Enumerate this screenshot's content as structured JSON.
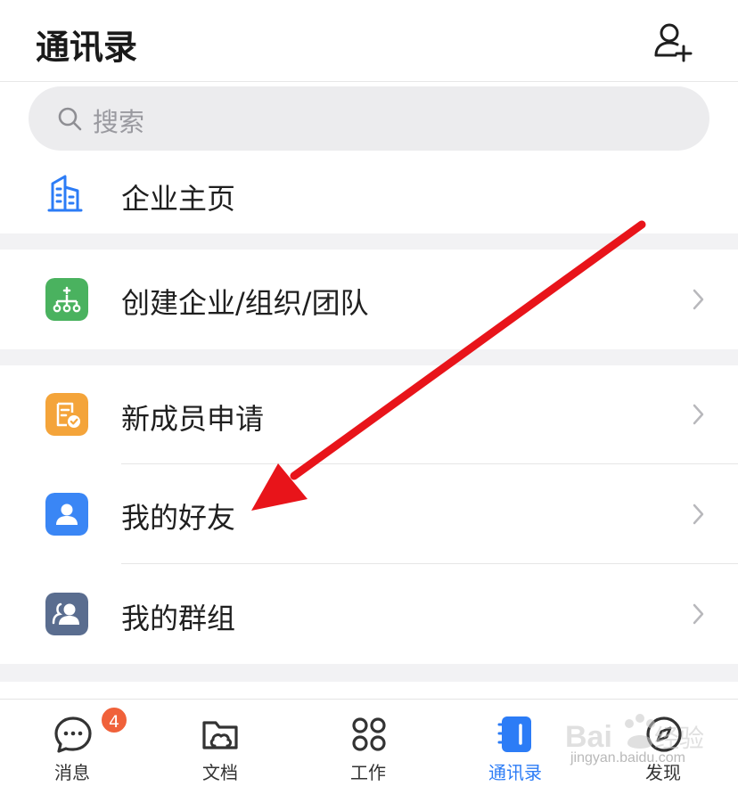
{
  "header": {
    "title": "通讯录",
    "add_icon": "add-contact-icon"
  },
  "search": {
    "placeholder": "搜索",
    "icon": "search-icon"
  },
  "sections": {
    "enterprise_home": {
      "label": "企业主页",
      "icon": "building-icon",
      "color": "#2c7cf6"
    },
    "create_org": {
      "label": "创建企业/组织/团队",
      "icon": "org-tree-icon",
      "color": "#4ab25f"
    },
    "new_member": {
      "label": "新成员申请",
      "icon": "application-icon",
      "color": "#f4a43a"
    },
    "my_friends": {
      "label": "我的好友",
      "icon": "person-icon",
      "color": "#3a86f5"
    },
    "my_groups": {
      "label": "我的群组",
      "icon": "group-icon",
      "color": "#5a6d8f"
    }
  },
  "tabbar": {
    "tabs": [
      {
        "label": "消息",
        "icon": "message-icon",
        "badge": "4",
        "active": false
      },
      {
        "label": "文档",
        "icon": "folder-icon",
        "active": false
      },
      {
        "label": "工作",
        "icon": "apps-grid-icon",
        "active": false
      },
      {
        "label": "通讯录",
        "icon": "contacts-book-icon",
        "active": true
      },
      {
        "label": "发现",
        "icon": "compass-icon",
        "active": false
      }
    ]
  },
  "watermark": {
    "text": "jingyan.baidu.com"
  },
  "colors": {
    "accent": "#2c7cf6",
    "arrow": "#e8141a",
    "gap": "#f2f2f4"
  }
}
